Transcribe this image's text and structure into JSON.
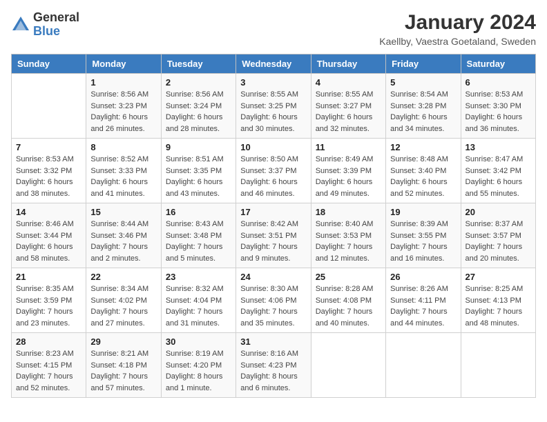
{
  "header": {
    "logo_general": "General",
    "logo_blue": "Blue",
    "month_year": "January 2024",
    "location": "Kaellby, Vaestra Goetaland, Sweden"
  },
  "days_of_week": [
    "Sunday",
    "Monday",
    "Tuesday",
    "Wednesday",
    "Thursday",
    "Friday",
    "Saturday"
  ],
  "weeks": [
    [
      {
        "day": "",
        "details": ""
      },
      {
        "day": "1",
        "details": "Sunrise: 8:56 AM\nSunset: 3:23 PM\nDaylight: 6 hours\nand 26 minutes."
      },
      {
        "day": "2",
        "details": "Sunrise: 8:56 AM\nSunset: 3:24 PM\nDaylight: 6 hours\nand 28 minutes."
      },
      {
        "day": "3",
        "details": "Sunrise: 8:55 AM\nSunset: 3:25 PM\nDaylight: 6 hours\nand 30 minutes."
      },
      {
        "day": "4",
        "details": "Sunrise: 8:55 AM\nSunset: 3:27 PM\nDaylight: 6 hours\nand 32 minutes."
      },
      {
        "day": "5",
        "details": "Sunrise: 8:54 AM\nSunset: 3:28 PM\nDaylight: 6 hours\nand 34 minutes."
      },
      {
        "day": "6",
        "details": "Sunrise: 8:53 AM\nSunset: 3:30 PM\nDaylight: 6 hours\nand 36 minutes."
      }
    ],
    [
      {
        "day": "7",
        "details": "Sunrise: 8:53 AM\nSunset: 3:32 PM\nDaylight: 6 hours\nand 38 minutes."
      },
      {
        "day": "8",
        "details": "Sunrise: 8:52 AM\nSunset: 3:33 PM\nDaylight: 6 hours\nand 41 minutes."
      },
      {
        "day": "9",
        "details": "Sunrise: 8:51 AM\nSunset: 3:35 PM\nDaylight: 6 hours\nand 43 minutes."
      },
      {
        "day": "10",
        "details": "Sunrise: 8:50 AM\nSunset: 3:37 PM\nDaylight: 6 hours\nand 46 minutes."
      },
      {
        "day": "11",
        "details": "Sunrise: 8:49 AM\nSunset: 3:39 PM\nDaylight: 6 hours\nand 49 minutes."
      },
      {
        "day": "12",
        "details": "Sunrise: 8:48 AM\nSunset: 3:40 PM\nDaylight: 6 hours\nand 52 minutes."
      },
      {
        "day": "13",
        "details": "Sunrise: 8:47 AM\nSunset: 3:42 PM\nDaylight: 6 hours\nand 55 minutes."
      }
    ],
    [
      {
        "day": "14",
        "details": "Sunrise: 8:46 AM\nSunset: 3:44 PM\nDaylight: 6 hours\nand 58 minutes."
      },
      {
        "day": "15",
        "details": "Sunrise: 8:44 AM\nSunset: 3:46 PM\nDaylight: 7 hours\nand 2 minutes."
      },
      {
        "day": "16",
        "details": "Sunrise: 8:43 AM\nSunset: 3:48 PM\nDaylight: 7 hours\nand 5 minutes."
      },
      {
        "day": "17",
        "details": "Sunrise: 8:42 AM\nSunset: 3:51 PM\nDaylight: 7 hours\nand 9 minutes."
      },
      {
        "day": "18",
        "details": "Sunrise: 8:40 AM\nSunset: 3:53 PM\nDaylight: 7 hours\nand 12 minutes."
      },
      {
        "day": "19",
        "details": "Sunrise: 8:39 AM\nSunset: 3:55 PM\nDaylight: 7 hours\nand 16 minutes."
      },
      {
        "day": "20",
        "details": "Sunrise: 8:37 AM\nSunset: 3:57 PM\nDaylight: 7 hours\nand 20 minutes."
      }
    ],
    [
      {
        "day": "21",
        "details": "Sunrise: 8:35 AM\nSunset: 3:59 PM\nDaylight: 7 hours\nand 23 minutes."
      },
      {
        "day": "22",
        "details": "Sunrise: 8:34 AM\nSunset: 4:02 PM\nDaylight: 7 hours\nand 27 minutes."
      },
      {
        "day": "23",
        "details": "Sunrise: 8:32 AM\nSunset: 4:04 PM\nDaylight: 7 hours\nand 31 minutes."
      },
      {
        "day": "24",
        "details": "Sunrise: 8:30 AM\nSunset: 4:06 PM\nDaylight: 7 hours\nand 35 minutes."
      },
      {
        "day": "25",
        "details": "Sunrise: 8:28 AM\nSunset: 4:08 PM\nDaylight: 7 hours\nand 40 minutes."
      },
      {
        "day": "26",
        "details": "Sunrise: 8:26 AM\nSunset: 4:11 PM\nDaylight: 7 hours\nand 44 minutes."
      },
      {
        "day": "27",
        "details": "Sunrise: 8:25 AM\nSunset: 4:13 PM\nDaylight: 7 hours\nand 48 minutes."
      }
    ],
    [
      {
        "day": "28",
        "details": "Sunrise: 8:23 AM\nSunset: 4:15 PM\nDaylight: 7 hours\nand 52 minutes."
      },
      {
        "day": "29",
        "details": "Sunrise: 8:21 AM\nSunset: 4:18 PM\nDaylight: 7 hours\nand 57 minutes."
      },
      {
        "day": "30",
        "details": "Sunrise: 8:19 AM\nSunset: 4:20 PM\nDaylight: 8 hours\nand 1 minute."
      },
      {
        "day": "31",
        "details": "Sunrise: 8:16 AM\nSunset: 4:23 PM\nDaylight: 8 hours\nand 6 minutes."
      },
      {
        "day": "",
        "details": ""
      },
      {
        "day": "",
        "details": ""
      },
      {
        "day": "",
        "details": ""
      }
    ]
  ]
}
